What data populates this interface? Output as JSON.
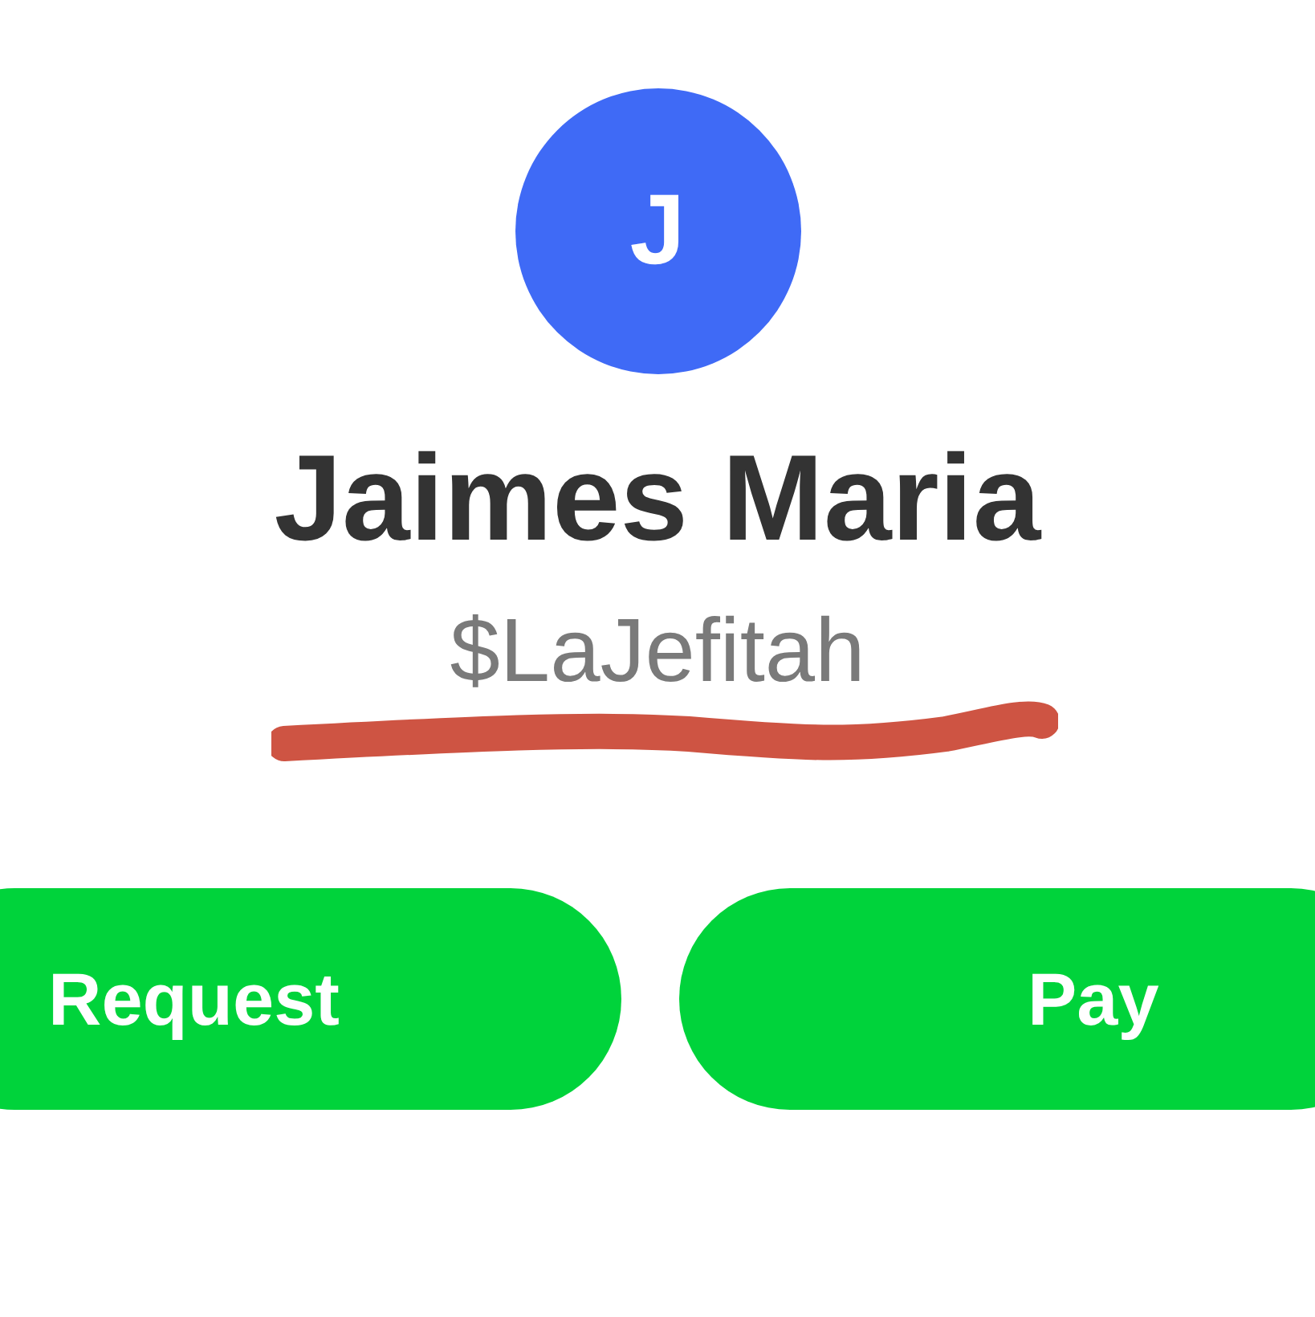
{
  "profile": {
    "avatar_initial": "J",
    "name": "Jaimes Maria",
    "cashtag": "$LaJefitah"
  },
  "buttons": [
    {
      "label": "Request",
      "kind": "request"
    },
    {
      "label": "Pay",
      "kind": "pay"
    }
  ]
}
